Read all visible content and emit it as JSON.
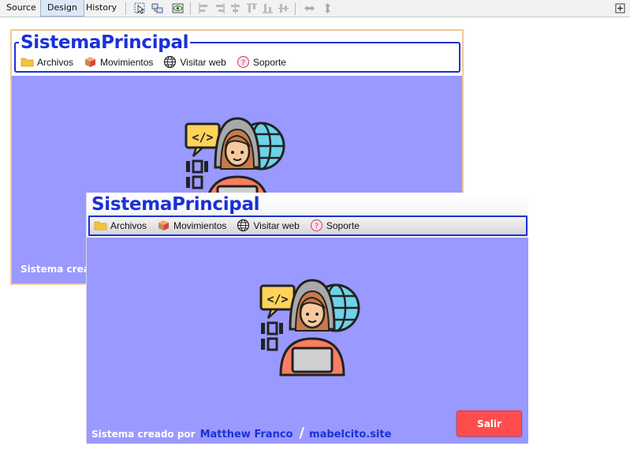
{
  "ide": {
    "tabs": [
      {
        "label": "Source",
        "active": false
      },
      {
        "label": "Design",
        "active": true
      },
      {
        "label": "History",
        "active": false
      }
    ],
    "toolbar_icons": [
      "selection-mode-icon",
      "connection-mode-icon",
      "preview-design-icon",
      "align-left-icon",
      "align-right-icon",
      "center-horizontal-icon",
      "align-top-icon",
      "align-bottom-icon",
      "center-vertical-icon",
      "resize-horizontal-icon",
      "resize-vertical-icon",
      "maximize-icon"
    ]
  },
  "app": {
    "title": "SistemaPrincipal",
    "menu": [
      {
        "label": "Archivos",
        "icon": "folder-icon"
      },
      {
        "label": "Movimientos",
        "icon": "box-icon"
      },
      {
        "label": "Visitar web",
        "icon": "globe-icon"
      },
      {
        "label": "Soporte",
        "icon": "help-icon"
      }
    ],
    "footer": {
      "prefix": "Sistema creado por",
      "prefix_back": "Sistema cread",
      "author": "Matthew Franco",
      "separator": "/",
      "site": "mabelcito.site"
    },
    "exit_button": "Salir"
  },
  "colors": {
    "background": "#9999ff",
    "title": "#1a31d6",
    "exit": "#ff4d4d"
  }
}
